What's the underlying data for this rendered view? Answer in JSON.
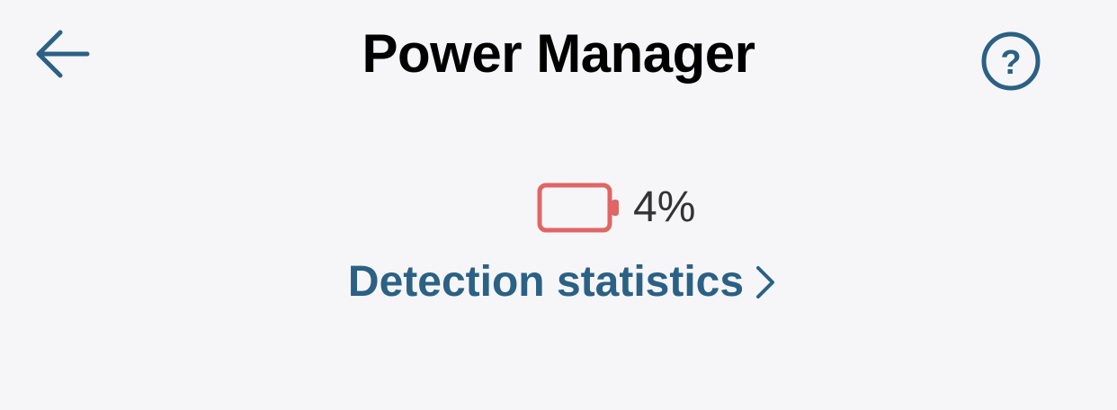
{
  "header": {
    "title": "Power Manager",
    "back_icon": "arrow-left-icon",
    "help_icon": "question-circle-icon"
  },
  "battery": {
    "level_percent": 4,
    "label": "4%",
    "icon": "battery-empty-icon",
    "color": "#e06666"
  },
  "stats_link": {
    "label": "Detection statistics",
    "icon": "chevron-right-icon"
  },
  "colors": {
    "accent": "#2b6184",
    "background": "#f6f6f9",
    "battery_low": "#e06666"
  }
}
